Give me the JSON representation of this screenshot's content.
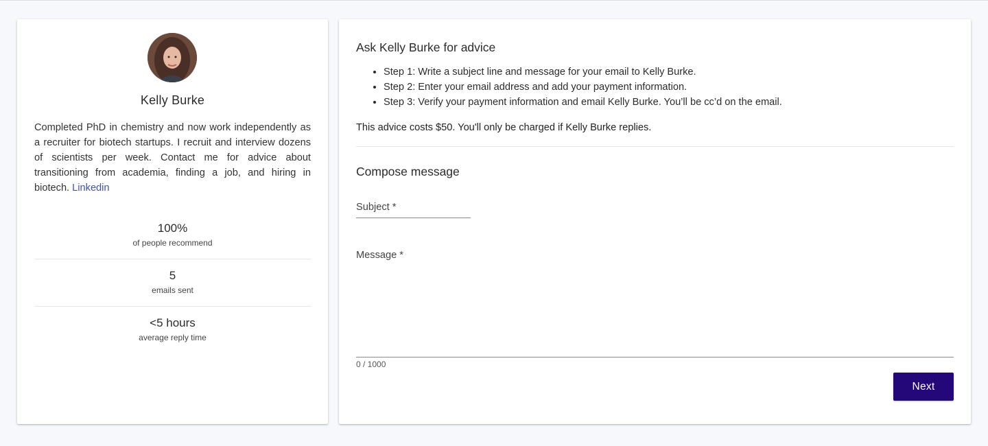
{
  "profile": {
    "name": "Kelly Burke",
    "bio": "Completed PhD in chemistry and now work independently as a recruiter for biotech startups. I recruit and interview dozens of scientists per week. Contact me for advice about transitioning from academia, finding a job, and hiring in biotech. ",
    "link_label": "Linkedin",
    "stats": [
      {
        "value": "100%",
        "label": "of people recommend"
      },
      {
        "value": "5",
        "label": "emails sent"
      },
      {
        "value": "<5 hours",
        "label": "average reply time"
      }
    ]
  },
  "ask": {
    "title": "Ask Kelly Burke for advice",
    "steps": [
      "Step 1: Write a subject line and message for your email to Kelly Burke.",
      "Step 2: Enter your email address and add your payment information.",
      "Step 3: Verify your payment information and email Kelly Burke. You’ll be cc’d on the email."
    ],
    "cost_text": "This advice costs $50. You'll only be charged if Kelly Burke replies."
  },
  "compose": {
    "title": "Compose message",
    "subject_label": "Subject *",
    "message_label": "Message *",
    "counter": "0 / 1000",
    "next_label": "Next"
  },
  "colors": {
    "accent": "#24087a",
    "link": "#3f51b5",
    "background": "#f7f8fb"
  }
}
